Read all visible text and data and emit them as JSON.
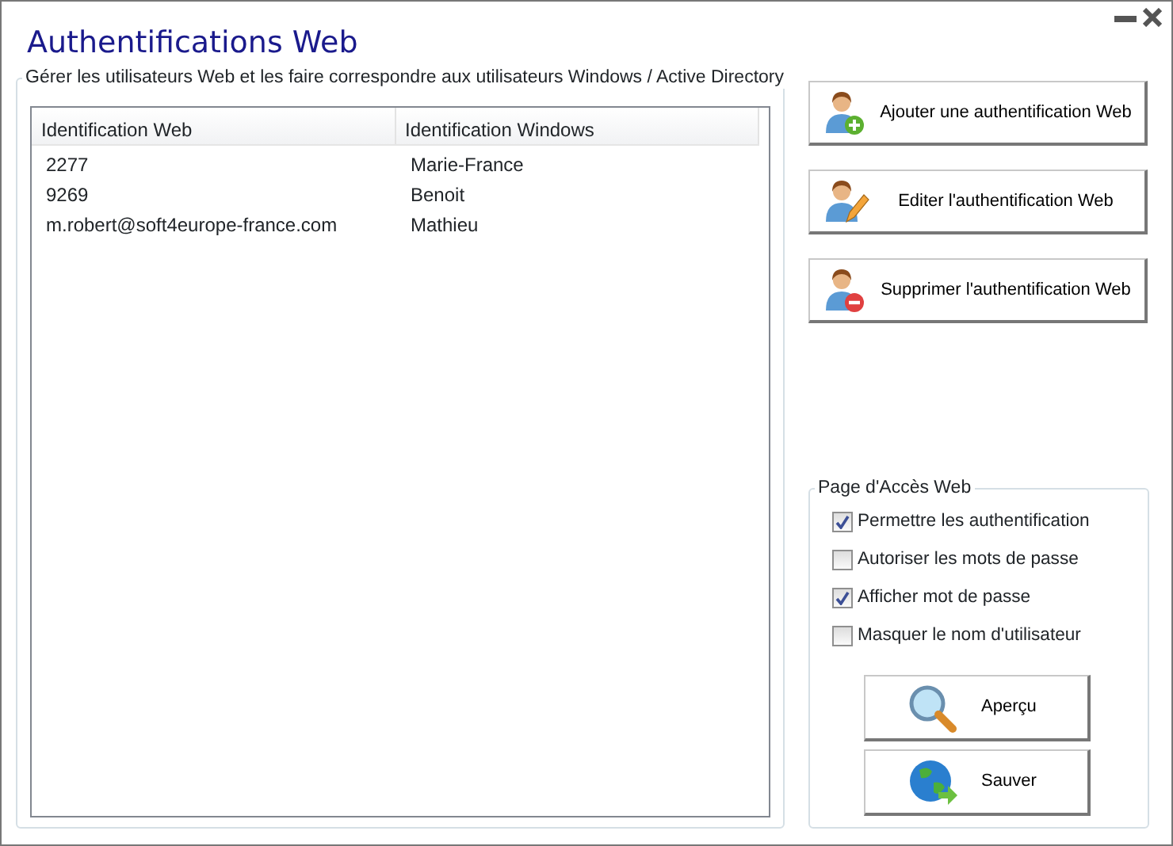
{
  "window": {
    "title": "Authentifications Web"
  },
  "mapping_group": {
    "legend": "Gérer les utilisateurs Web et les faire correspondre aux utilisateurs Windows / Active Directory",
    "columns": [
      "Identification Web",
      "Identification Windows"
    ],
    "rows": [
      [
        "2277",
        "Marie-France"
      ],
      [
        "9269",
        "Benoit"
      ],
      [
        "m.robert@soft4europe-france.com",
        "Mathieu"
      ]
    ]
  },
  "actions": [
    {
      "label": "Ajouter une authentification Web",
      "kind": "add"
    },
    {
      "label": "Editer l'authentification Web",
      "kind": "edit"
    },
    {
      "label": "Supprimer l'authentification Web",
      "kind": "delete"
    }
  ],
  "web_access": {
    "legend": "Page d'Accès Web",
    "options": [
      {
        "label": "Permettre les authentification",
        "checked": true
      },
      {
        "label": "Autoriser les mots de passe",
        "checked": false
      },
      {
        "label": "Afficher mot de passe",
        "checked": true
      },
      {
        "label": "Masquer le nom d'utilisateur",
        "checked": false
      }
    ],
    "buttons": [
      {
        "label": "Aperçu",
        "kind": "preview"
      },
      {
        "label": "Sauver",
        "kind": "save"
      }
    ]
  }
}
